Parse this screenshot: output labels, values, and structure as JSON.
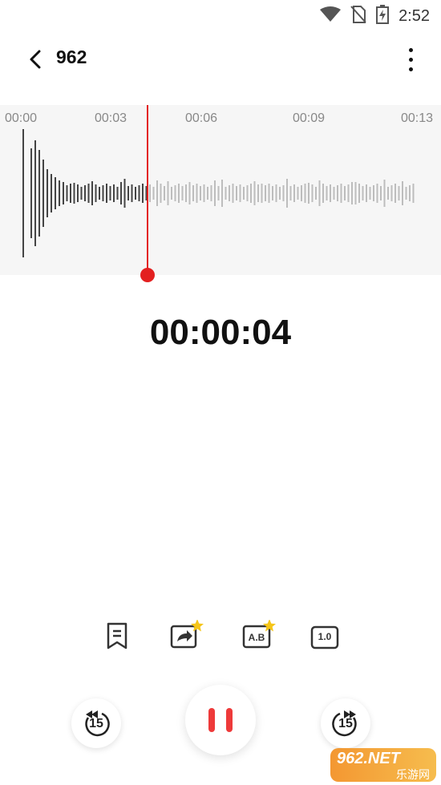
{
  "status_bar": {
    "time": "2:52"
  },
  "app_bar": {
    "title": "962"
  },
  "timeline": {
    "ticks": [
      "00:00",
      "00:03",
      "00:06",
      "00:09",
      "00:13"
    ]
  },
  "playback": {
    "elapsed": "00:00:04",
    "speed": "1.0"
  },
  "tools": {
    "ab_label": "A.B"
  },
  "controls": {
    "rewind_seconds": "15",
    "forward_seconds": "15"
  },
  "watermark": {
    "brand": "962.NET",
    "sub": "乐游网"
  },
  "colors": {
    "accent": "#e32020",
    "pause": "#ee3a3a",
    "star": "#f5c518"
  }
}
